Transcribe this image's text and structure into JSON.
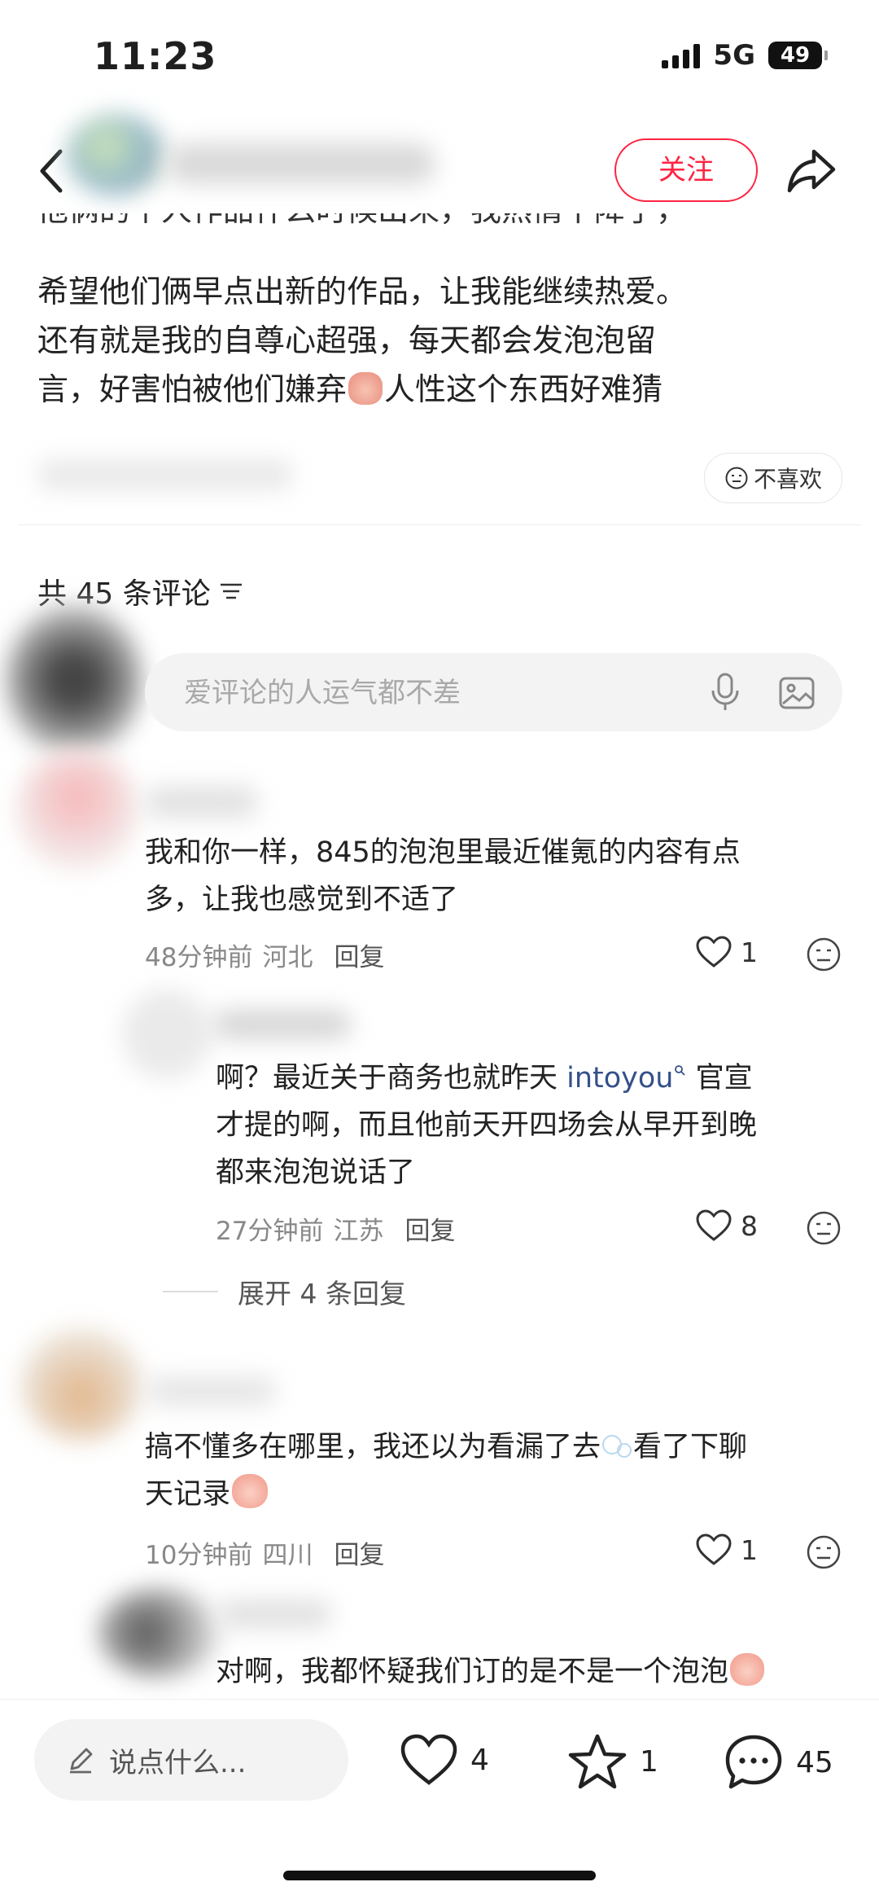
{
  "status_bar": {
    "time": "11:23",
    "network": "5G",
    "battery": "49"
  },
  "header": {
    "follow_label": "关注"
  },
  "post": {
    "lines": [
      "希望他们俩早点出新的作品，让我能继续热爱。",
      "还有就是我的自尊心超强，每天都会发泡泡留",
      "言，好害怕被他们嫌弃",
      "人性这个东西好难猜"
    ],
    "cut_line": "他俩的个人作品什么时候出来，我热情下降了，"
  },
  "dislike_label": "不喜欢",
  "comments_header": {
    "label": "共 45 条评论"
  },
  "comment_input": {
    "placeholder": "爱评论的人运气都不差"
  },
  "comments": [
    {
      "lines": [
        "我和你一样，845的泡泡里最近催氪的内容有点",
        "多，让我也感觉到不适了"
      ],
      "time": "48分钟前",
      "location": "河北",
      "reply_label": "回复",
      "likes": "1"
    },
    {
      "text_a": "啊？最近关于商务也就昨天 ",
      "mention": "intoyou",
      "text_b": " 官宣",
      "lines": [
        "才提的啊，而且他前天开四场会从早开到晚",
        "都来泡泡说话了"
      ],
      "time": "27分钟前",
      "location": "江苏",
      "reply_label": "回复",
      "likes": "8"
    },
    {
      "text_a": "搞不懂多在哪里，我还以为看漏了去",
      "text_b": "看了下聊",
      "line2": "天记录",
      "time": "10分钟前",
      "location": "四川",
      "reply_label": "回复",
      "likes": "1"
    },
    {
      "text": "对啊，我都怀疑我们订的是不是一个泡泡"
    }
  ],
  "expand_replies": "展开 4 条回复",
  "bottom_bar": {
    "say_placeholder": "说点什么...",
    "likes": "4",
    "favorites": "1",
    "comments": "45"
  },
  "colors": {
    "accent": "#ff2442",
    "mention": "#35508a",
    "muted": "#888888"
  }
}
